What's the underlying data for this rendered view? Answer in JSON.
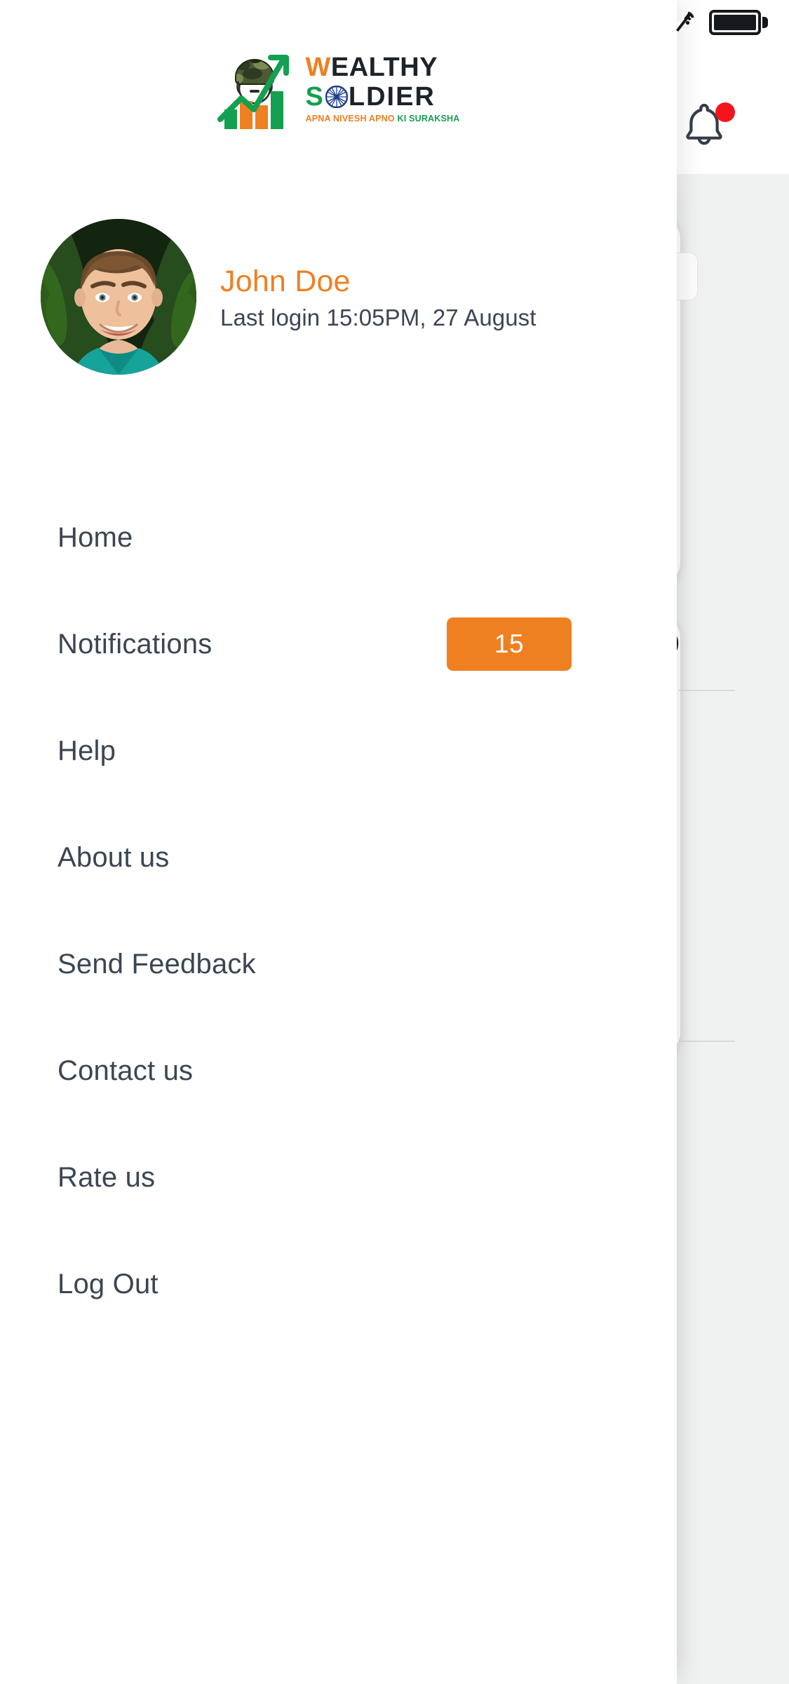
{
  "status_bar": {
    "wifi_icon": "wifi-icon",
    "battery_icon": "battery-full-icon"
  },
  "header": {
    "notification_bell_icon": "bell-icon",
    "notification_dot": "unread-indicator",
    "dot_color": "#f5141e"
  },
  "brand": {
    "mark_icon": "soldier-growth-chart-logo",
    "line1_accent": "W",
    "line1_rest": "EALTHY",
    "line2_accent": "S",
    "line2_wheel_icon": "ashoka-chakra-icon",
    "line2_rest": "LDIER",
    "tagline_part1": "APNA NIVESH APNO",
    "tagline_part2": "KI SURAKSHA",
    "orange": "#ee8022",
    "green": "#13a050",
    "dark": "#1d232a"
  },
  "profile": {
    "avatar_icon": "user-avatar-photo",
    "name": "John Doe",
    "last_login": "Last login 15:05PM, 27 August",
    "name_color": "#ef8022"
  },
  "menu": {
    "items": [
      {
        "label": "Home",
        "name": "home",
        "badge": null
      },
      {
        "label": "Notifications",
        "name": "notifications",
        "badge": "15"
      },
      {
        "label": "Help",
        "name": "help",
        "badge": null
      },
      {
        "label": "About us",
        "name": "about-us",
        "badge": null
      },
      {
        "label": "Send Feedback",
        "name": "send-feedback",
        "badge": null
      },
      {
        "label": "Contact us",
        "name": "contact-us",
        "badge": null
      },
      {
        "label": "Rate us",
        "name": "rate-us",
        "badge": null
      },
      {
        "label": "Log Out",
        "name": "log-out",
        "badge": null
      }
    ],
    "badge_color": "#ef8022",
    "label_color": "#3b4652"
  },
  "background_app": {
    "partial_glyph": ")"
  }
}
